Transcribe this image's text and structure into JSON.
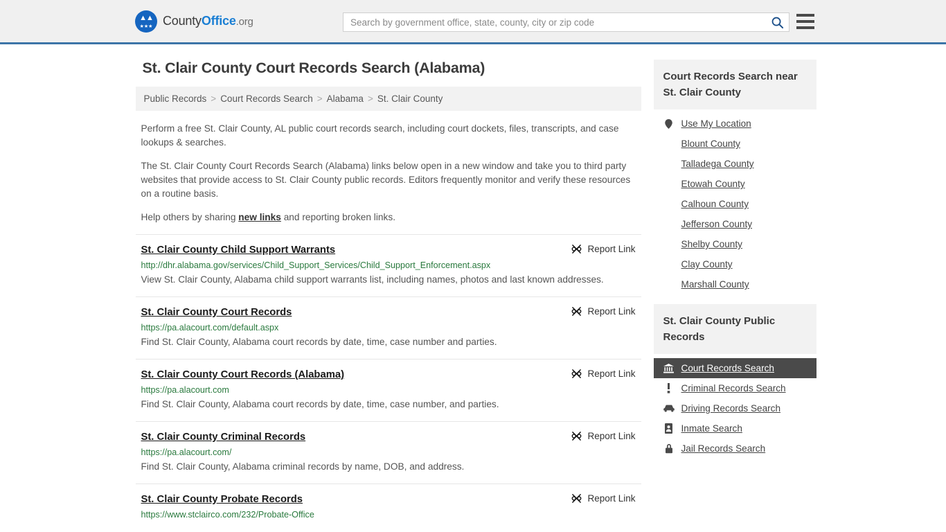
{
  "header": {
    "logo": {
      "icon": "eagle-seal-icon",
      "text_part1": "County",
      "text_part2": "Office",
      "text_part3": ".org"
    },
    "search": {
      "placeholder": "Search by government office, state, county, city or zip code",
      "value": "",
      "icon": "search-icon"
    },
    "menu_icon": "hamburger-menu-icon",
    "accent_color": "#3d75a8"
  },
  "main": {
    "title": "St. Clair County Court Records Search (Alabama)",
    "breadcrumb": [
      "Public Records",
      "Court Records Search",
      "Alabama",
      "St. Clair County"
    ],
    "breadcrumb_separator": ">",
    "intro": {
      "p1": "Perform a free St. Clair County, AL public court records search, including court dockets, files, transcripts, and case lookups & searches.",
      "p2": "The St. Clair County Court Records Search (Alabama) links below open in a new window and take you to third party websites that provide access to St. Clair County public records. Editors frequently monitor and verify these resources on a routine basis.",
      "p3_before": "Help others by sharing ",
      "p3_link": "new links",
      "p3_after": " and reporting broken links."
    },
    "report_link_label": "Report Link",
    "report_link_icon": "broken-link-icon",
    "results": [
      {
        "title": "St. Clair County Child Support Warrants",
        "url": "http://dhr.alabama.gov/services/Child_Support_Services/Child_Support_Enforcement.aspx",
        "description": "View St. Clair County, Alabama child support warrants list, including names, photos and last known addresses."
      },
      {
        "title": "St. Clair County Court Records",
        "url": "https://pa.alacourt.com/default.aspx",
        "description": "Find St. Clair County, Alabama court records by date, time, case number and parties."
      },
      {
        "title": "St. Clair County Court Records (Alabama)",
        "url": "https://pa.alacourt.com",
        "description": "Find St. Clair County, Alabama court records by date, time, case number, and parties."
      },
      {
        "title": "St. Clair County Criminal Records",
        "url": "https://pa.alacourt.com/",
        "description": "Find St. Clair County, Alabama criminal records by name, DOB, and address."
      },
      {
        "title": "St. Clair County Probate Records",
        "url": "https://www.stclairco.com/232/Probate-Office",
        "description": ""
      }
    ]
  },
  "sidebar": {
    "nearby": {
      "heading": "Court Records Search near St. Clair County",
      "items": [
        {
          "label": "Use My Location",
          "icon": "map-pin-icon",
          "glyph": "•"
        },
        {
          "label": "Blount County",
          "icon": "",
          "glyph": ""
        },
        {
          "label": "Talladega County",
          "icon": "",
          "glyph": ""
        },
        {
          "label": "Etowah County",
          "icon": "",
          "glyph": ""
        },
        {
          "label": "Calhoun County",
          "icon": "",
          "glyph": ""
        },
        {
          "label": "Jefferson County",
          "icon": "",
          "glyph": ""
        },
        {
          "label": "Shelby County",
          "icon": "",
          "glyph": ""
        },
        {
          "label": "Clay County",
          "icon": "",
          "glyph": ""
        },
        {
          "label": "Marshall County",
          "icon": "",
          "glyph": ""
        }
      ]
    },
    "public_records": {
      "heading": "St. Clair County Public Records",
      "active_index": 0,
      "items": [
        {
          "label": "Court Records Search",
          "icon": "courthouse-icon",
          "glyph": "🏛"
        },
        {
          "label": "Criminal Records Search",
          "icon": "exclamation-icon",
          "glyph": "❗"
        },
        {
          "label": "Driving Records Search",
          "icon": "car-icon",
          "glyph": "🚗"
        },
        {
          "label": "Inmate Search",
          "icon": "id-badge-icon",
          "glyph": "📇"
        },
        {
          "label": "Jail Records Search",
          "icon": "lock-icon",
          "glyph": "🔒"
        }
      ]
    }
  }
}
